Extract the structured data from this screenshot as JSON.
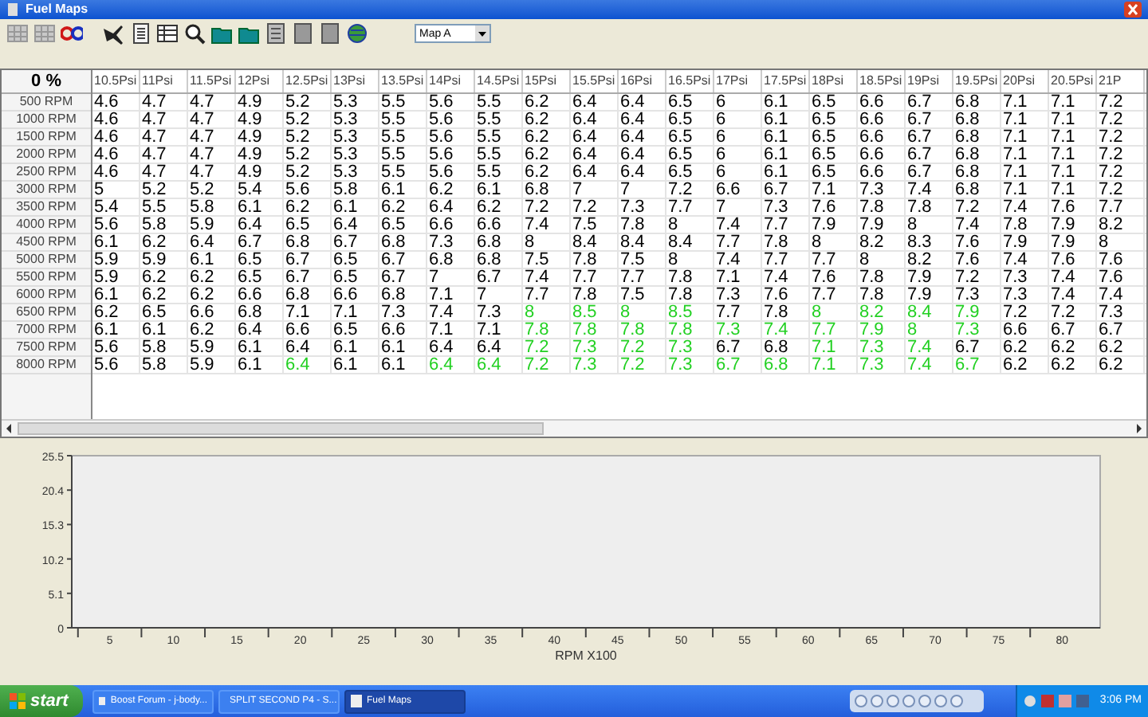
{
  "window": {
    "title": "Fuel Maps"
  },
  "toolbar": {
    "map_select": "Map A"
  },
  "table": {
    "corner": "0 %",
    "columns": [
      "10.5Psi",
      "11Psi",
      "11.5Psi",
      "12Psi",
      "12.5Psi",
      "13Psi",
      "13.5Psi",
      "14Psi",
      "14.5Psi",
      "15Psi",
      "15.5Psi",
      "16Psi",
      "16.5Psi",
      "17Psi",
      "17.5Psi",
      "18Psi",
      "18.5Psi",
      "19Psi",
      "19.5Psi",
      "20Psi",
      "20.5Psi",
      "21P"
    ],
    "rows": [
      {
        "label": "500 RPM",
        "cells": [
          {
            "value": "4.6",
            "highlighted": false
          },
          {
            "value": "4.7",
            "highlighted": false
          },
          {
            "value": "4.7",
            "highlighted": false
          },
          {
            "value": "4.9",
            "highlighted": false
          },
          {
            "value": "5.2",
            "highlighted": false
          },
          {
            "value": "5.3",
            "highlighted": false
          },
          {
            "value": "5.5",
            "highlighted": false
          },
          {
            "value": "5.6",
            "highlighted": false
          },
          {
            "value": "5.5",
            "highlighted": false
          },
          {
            "value": "6.2",
            "highlighted": false
          },
          {
            "value": "6.4",
            "highlighted": false
          },
          {
            "value": "6.4",
            "highlighted": false
          },
          {
            "value": "6.5",
            "highlighted": false
          },
          {
            "value": "6",
            "highlighted": false
          },
          {
            "value": "6.1",
            "highlighted": false
          },
          {
            "value": "6.5",
            "highlighted": false
          },
          {
            "value": "6.6",
            "highlighted": false
          },
          {
            "value": "6.7",
            "highlighted": false
          },
          {
            "value": "6.8",
            "highlighted": false
          },
          {
            "value": "7.1",
            "highlighted": false
          },
          {
            "value": "7.1",
            "highlighted": false
          },
          {
            "value": "7.2",
            "highlighted": false
          }
        ]
      },
      {
        "label": "1000 RPM",
        "cells": [
          {
            "value": "4.6",
            "highlighted": false
          },
          {
            "value": "4.7",
            "highlighted": false
          },
          {
            "value": "4.7",
            "highlighted": false
          },
          {
            "value": "4.9",
            "highlighted": false
          },
          {
            "value": "5.2",
            "highlighted": false
          },
          {
            "value": "5.3",
            "highlighted": false
          },
          {
            "value": "5.5",
            "highlighted": false
          },
          {
            "value": "5.6",
            "highlighted": false
          },
          {
            "value": "5.5",
            "highlighted": false
          },
          {
            "value": "6.2",
            "highlighted": false
          },
          {
            "value": "6.4",
            "highlighted": false
          },
          {
            "value": "6.4",
            "highlighted": false
          },
          {
            "value": "6.5",
            "highlighted": false
          },
          {
            "value": "6",
            "highlighted": false
          },
          {
            "value": "6.1",
            "highlighted": false
          },
          {
            "value": "6.5",
            "highlighted": false
          },
          {
            "value": "6.6",
            "highlighted": false
          },
          {
            "value": "6.7",
            "highlighted": false
          },
          {
            "value": "6.8",
            "highlighted": false
          },
          {
            "value": "7.1",
            "highlighted": false
          },
          {
            "value": "7.1",
            "highlighted": false
          },
          {
            "value": "7.2",
            "highlighted": false
          }
        ]
      },
      {
        "label": "1500 RPM",
        "cells": [
          {
            "value": "4.6",
            "highlighted": false
          },
          {
            "value": "4.7",
            "highlighted": false
          },
          {
            "value": "4.7",
            "highlighted": false
          },
          {
            "value": "4.9",
            "highlighted": false
          },
          {
            "value": "5.2",
            "highlighted": false
          },
          {
            "value": "5.3",
            "highlighted": false
          },
          {
            "value": "5.5",
            "highlighted": false
          },
          {
            "value": "5.6",
            "highlighted": false
          },
          {
            "value": "5.5",
            "highlighted": false
          },
          {
            "value": "6.2",
            "highlighted": false
          },
          {
            "value": "6.4",
            "highlighted": false
          },
          {
            "value": "6.4",
            "highlighted": false
          },
          {
            "value": "6.5",
            "highlighted": false
          },
          {
            "value": "6",
            "highlighted": false
          },
          {
            "value": "6.1",
            "highlighted": false
          },
          {
            "value": "6.5",
            "highlighted": false
          },
          {
            "value": "6.6",
            "highlighted": false
          },
          {
            "value": "6.7",
            "highlighted": false
          },
          {
            "value": "6.8",
            "highlighted": false
          },
          {
            "value": "7.1",
            "highlighted": false
          },
          {
            "value": "7.1",
            "highlighted": false
          },
          {
            "value": "7.2",
            "highlighted": false
          }
        ]
      },
      {
        "label": "2000 RPM",
        "cells": [
          {
            "value": "4.6",
            "highlighted": false
          },
          {
            "value": "4.7",
            "highlighted": false
          },
          {
            "value": "4.7",
            "highlighted": false
          },
          {
            "value": "4.9",
            "highlighted": false
          },
          {
            "value": "5.2",
            "highlighted": false
          },
          {
            "value": "5.3",
            "highlighted": false
          },
          {
            "value": "5.5",
            "highlighted": false
          },
          {
            "value": "5.6",
            "highlighted": false
          },
          {
            "value": "5.5",
            "highlighted": false
          },
          {
            "value": "6.2",
            "highlighted": false
          },
          {
            "value": "6.4",
            "highlighted": false
          },
          {
            "value": "6.4",
            "highlighted": false
          },
          {
            "value": "6.5",
            "highlighted": false
          },
          {
            "value": "6",
            "highlighted": false
          },
          {
            "value": "6.1",
            "highlighted": false
          },
          {
            "value": "6.5",
            "highlighted": false
          },
          {
            "value": "6.6",
            "highlighted": false
          },
          {
            "value": "6.7",
            "highlighted": false
          },
          {
            "value": "6.8",
            "highlighted": false
          },
          {
            "value": "7.1",
            "highlighted": false
          },
          {
            "value": "7.1",
            "highlighted": false
          },
          {
            "value": "7.2",
            "highlighted": false
          }
        ]
      },
      {
        "label": "2500 RPM",
        "cells": [
          {
            "value": "4.6",
            "highlighted": false
          },
          {
            "value": "4.7",
            "highlighted": false
          },
          {
            "value": "4.7",
            "highlighted": false
          },
          {
            "value": "4.9",
            "highlighted": false
          },
          {
            "value": "5.2",
            "highlighted": false
          },
          {
            "value": "5.3",
            "highlighted": false
          },
          {
            "value": "5.5",
            "highlighted": false
          },
          {
            "value": "5.6",
            "highlighted": false
          },
          {
            "value": "5.5",
            "highlighted": false
          },
          {
            "value": "6.2",
            "highlighted": false
          },
          {
            "value": "6.4",
            "highlighted": false
          },
          {
            "value": "6.4",
            "highlighted": false
          },
          {
            "value": "6.5",
            "highlighted": false
          },
          {
            "value": "6",
            "highlighted": false
          },
          {
            "value": "6.1",
            "highlighted": false
          },
          {
            "value": "6.5",
            "highlighted": false
          },
          {
            "value": "6.6",
            "highlighted": false
          },
          {
            "value": "6.7",
            "highlighted": false
          },
          {
            "value": "6.8",
            "highlighted": false
          },
          {
            "value": "7.1",
            "highlighted": false
          },
          {
            "value": "7.1",
            "highlighted": false
          },
          {
            "value": "7.2",
            "highlighted": false
          }
        ]
      },
      {
        "label": "3000 RPM",
        "cells": [
          {
            "value": "5",
            "highlighted": false
          },
          {
            "value": "5.2",
            "highlighted": false
          },
          {
            "value": "5.2",
            "highlighted": false
          },
          {
            "value": "5.4",
            "highlighted": false
          },
          {
            "value": "5.6",
            "highlighted": false
          },
          {
            "value": "5.8",
            "highlighted": false
          },
          {
            "value": "6.1",
            "highlighted": false
          },
          {
            "value": "6.2",
            "highlighted": false
          },
          {
            "value": "6.1",
            "highlighted": false
          },
          {
            "value": "6.8",
            "highlighted": false
          },
          {
            "value": "7",
            "highlighted": false
          },
          {
            "value": "7",
            "highlighted": false
          },
          {
            "value": "7.2",
            "highlighted": false
          },
          {
            "value": "6.6",
            "highlighted": false
          },
          {
            "value": "6.7",
            "highlighted": false
          },
          {
            "value": "7.1",
            "highlighted": false
          },
          {
            "value": "7.3",
            "highlighted": false
          },
          {
            "value": "7.4",
            "highlighted": false
          },
          {
            "value": "6.8",
            "highlighted": false
          },
          {
            "value": "7.1",
            "highlighted": false
          },
          {
            "value": "7.1",
            "highlighted": false
          },
          {
            "value": "7.2",
            "highlighted": false
          }
        ]
      },
      {
        "label": "3500 RPM",
        "cells": [
          {
            "value": "5.4",
            "highlighted": false
          },
          {
            "value": "5.5",
            "highlighted": false
          },
          {
            "value": "5.8",
            "highlighted": false
          },
          {
            "value": "6.1",
            "highlighted": false
          },
          {
            "value": "6.2",
            "highlighted": false
          },
          {
            "value": "6.1",
            "highlighted": false
          },
          {
            "value": "6.2",
            "highlighted": false
          },
          {
            "value": "6.4",
            "highlighted": false
          },
          {
            "value": "6.2",
            "highlighted": false
          },
          {
            "value": "7.2",
            "highlighted": false
          },
          {
            "value": "7.2",
            "highlighted": false
          },
          {
            "value": "7.3",
            "highlighted": false
          },
          {
            "value": "7.7",
            "highlighted": false
          },
          {
            "value": "7",
            "highlighted": false
          },
          {
            "value": "7.3",
            "highlighted": false
          },
          {
            "value": "7.6",
            "highlighted": false
          },
          {
            "value": "7.8",
            "highlighted": false
          },
          {
            "value": "7.8",
            "highlighted": false
          },
          {
            "value": "7.2",
            "highlighted": false
          },
          {
            "value": "7.4",
            "highlighted": false
          },
          {
            "value": "7.6",
            "highlighted": false
          },
          {
            "value": "7.7",
            "highlighted": false
          }
        ]
      },
      {
        "label": "4000 RPM",
        "cells": [
          {
            "value": "5.6",
            "highlighted": false
          },
          {
            "value": "5.8",
            "highlighted": false
          },
          {
            "value": "5.9",
            "highlighted": false
          },
          {
            "value": "6.4",
            "highlighted": false
          },
          {
            "value": "6.5",
            "highlighted": false
          },
          {
            "value": "6.4",
            "highlighted": false
          },
          {
            "value": "6.5",
            "highlighted": false
          },
          {
            "value": "6.6",
            "highlighted": false
          },
          {
            "value": "6.6",
            "highlighted": false
          },
          {
            "value": "7.4",
            "highlighted": false
          },
          {
            "value": "7.5",
            "highlighted": false
          },
          {
            "value": "7.8",
            "highlighted": false
          },
          {
            "value": "8",
            "highlighted": false
          },
          {
            "value": "7.4",
            "highlighted": false
          },
          {
            "value": "7.7",
            "highlighted": false
          },
          {
            "value": "7.9",
            "highlighted": false
          },
          {
            "value": "7.9",
            "highlighted": false
          },
          {
            "value": "8",
            "highlighted": false
          },
          {
            "value": "7.4",
            "highlighted": false
          },
          {
            "value": "7.8",
            "highlighted": false
          },
          {
            "value": "7.9",
            "highlighted": false
          },
          {
            "value": "8.2",
            "highlighted": false
          }
        ]
      },
      {
        "label": "4500 RPM",
        "cells": [
          {
            "value": "6.1",
            "highlighted": false
          },
          {
            "value": "6.2",
            "highlighted": false
          },
          {
            "value": "6.4",
            "highlighted": false
          },
          {
            "value": "6.7",
            "highlighted": false
          },
          {
            "value": "6.8",
            "highlighted": false
          },
          {
            "value": "6.7",
            "highlighted": false
          },
          {
            "value": "6.8",
            "highlighted": false
          },
          {
            "value": "7.3",
            "highlighted": false
          },
          {
            "value": "6.8",
            "highlighted": false
          },
          {
            "value": "8",
            "highlighted": false
          },
          {
            "value": "8.4",
            "highlighted": false
          },
          {
            "value": "8.4",
            "highlighted": false
          },
          {
            "value": "8.4",
            "highlighted": false
          },
          {
            "value": "7.7",
            "highlighted": false
          },
          {
            "value": "7.8",
            "highlighted": false
          },
          {
            "value": "8",
            "highlighted": false
          },
          {
            "value": "8.2",
            "highlighted": false
          },
          {
            "value": "8.3",
            "highlighted": false
          },
          {
            "value": "7.6",
            "highlighted": false
          },
          {
            "value": "7.9",
            "highlighted": false
          },
          {
            "value": "7.9",
            "highlighted": false
          },
          {
            "value": "8",
            "highlighted": false
          }
        ]
      },
      {
        "label": "5000 RPM",
        "cells": [
          {
            "value": "5.9",
            "highlighted": false
          },
          {
            "value": "5.9",
            "highlighted": false
          },
          {
            "value": "6.1",
            "highlighted": false
          },
          {
            "value": "6.5",
            "highlighted": false
          },
          {
            "value": "6.7",
            "highlighted": false
          },
          {
            "value": "6.5",
            "highlighted": false
          },
          {
            "value": "6.7",
            "highlighted": false
          },
          {
            "value": "6.8",
            "highlighted": false
          },
          {
            "value": "6.8",
            "highlighted": false
          },
          {
            "value": "7.5",
            "highlighted": false
          },
          {
            "value": "7.8",
            "highlighted": false
          },
          {
            "value": "7.5",
            "highlighted": false
          },
          {
            "value": "8",
            "highlighted": false
          },
          {
            "value": "7.4",
            "highlighted": false
          },
          {
            "value": "7.7",
            "highlighted": false
          },
          {
            "value": "7.7",
            "highlighted": false
          },
          {
            "value": "8",
            "highlighted": false
          },
          {
            "value": "8.2",
            "highlighted": false
          },
          {
            "value": "7.6",
            "highlighted": false
          },
          {
            "value": "7.4",
            "highlighted": false
          },
          {
            "value": "7.6",
            "highlighted": false
          },
          {
            "value": "7.6",
            "highlighted": false
          }
        ]
      },
      {
        "label": "5500 RPM",
        "cells": [
          {
            "value": "5.9",
            "highlighted": false
          },
          {
            "value": "6.2",
            "highlighted": false
          },
          {
            "value": "6.2",
            "highlighted": false
          },
          {
            "value": "6.5",
            "highlighted": false
          },
          {
            "value": "6.7",
            "highlighted": false
          },
          {
            "value": "6.5",
            "highlighted": false
          },
          {
            "value": "6.7",
            "highlighted": false
          },
          {
            "value": "7",
            "highlighted": false
          },
          {
            "value": "6.7",
            "highlighted": false
          },
          {
            "value": "7.4",
            "highlighted": false
          },
          {
            "value": "7.7",
            "highlighted": false
          },
          {
            "value": "7.7",
            "highlighted": false
          },
          {
            "value": "7.8",
            "highlighted": false
          },
          {
            "value": "7.1",
            "highlighted": false
          },
          {
            "value": "7.4",
            "highlighted": false
          },
          {
            "value": "7.6",
            "highlighted": false
          },
          {
            "value": "7.8",
            "highlighted": false
          },
          {
            "value": "7.9",
            "highlighted": false
          },
          {
            "value": "7.2",
            "highlighted": false
          },
          {
            "value": "7.3",
            "highlighted": false
          },
          {
            "value": "7.4",
            "highlighted": false
          },
          {
            "value": "7.6",
            "highlighted": false
          }
        ]
      },
      {
        "label": "6000 RPM",
        "cells": [
          {
            "value": "6.1",
            "highlighted": false
          },
          {
            "value": "6.2",
            "highlighted": false
          },
          {
            "value": "6.2",
            "highlighted": false
          },
          {
            "value": "6.6",
            "highlighted": false
          },
          {
            "value": "6.8",
            "highlighted": false
          },
          {
            "value": "6.6",
            "highlighted": false
          },
          {
            "value": "6.8",
            "highlighted": false
          },
          {
            "value": "7.1",
            "highlighted": false
          },
          {
            "value": "7",
            "highlighted": false
          },
          {
            "value": "7.7",
            "highlighted": false
          },
          {
            "value": "7.8",
            "highlighted": false
          },
          {
            "value": "7.5",
            "highlighted": false
          },
          {
            "value": "7.8",
            "highlighted": false
          },
          {
            "value": "7.3",
            "highlighted": false
          },
          {
            "value": "7.6",
            "highlighted": false
          },
          {
            "value": "7.7",
            "highlighted": false
          },
          {
            "value": "7.8",
            "highlighted": false
          },
          {
            "value": "7.9",
            "highlighted": false
          },
          {
            "value": "7.3",
            "highlighted": false
          },
          {
            "value": "7.3",
            "highlighted": false
          },
          {
            "value": "7.4",
            "highlighted": false
          },
          {
            "value": "7.4",
            "highlighted": false
          }
        ]
      },
      {
        "label": "6500 RPM",
        "cells": [
          {
            "value": "6.2",
            "highlighted": false
          },
          {
            "value": "6.5",
            "highlighted": false
          },
          {
            "value": "6.6",
            "highlighted": false
          },
          {
            "value": "6.8",
            "highlighted": false
          },
          {
            "value": "7.1",
            "highlighted": false
          },
          {
            "value": "7.1",
            "highlighted": false
          },
          {
            "value": "7.3",
            "highlighted": false
          },
          {
            "value": "7.4",
            "highlighted": false
          },
          {
            "value": "7.3",
            "highlighted": false
          },
          {
            "value": "8",
            "highlighted": true
          },
          {
            "value": "8.5",
            "highlighted": true
          },
          {
            "value": "8",
            "highlighted": true
          },
          {
            "value": "8.5",
            "highlighted": true
          },
          {
            "value": "7.7",
            "highlighted": false
          },
          {
            "value": "7.8",
            "highlighted": false
          },
          {
            "value": "8",
            "highlighted": true
          },
          {
            "value": "8.2",
            "highlighted": true
          },
          {
            "value": "8.4",
            "highlighted": true
          },
          {
            "value": "7.9",
            "highlighted": true
          },
          {
            "value": "7.2",
            "highlighted": false
          },
          {
            "value": "7.2",
            "highlighted": false
          },
          {
            "value": "7.3",
            "highlighted": false
          }
        ]
      },
      {
        "label": "7000 RPM",
        "cells": [
          {
            "value": "6.1",
            "highlighted": false
          },
          {
            "value": "6.1",
            "highlighted": false
          },
          {
            "value": "6.2",
            "highlighted": false
          },
          {
            "value": "6.4",
            "highlighted": false
          },
          {
            "value": "6.6",
            "highlighted": false
          },
          {
            "value": "6.5",
            "highlighted": false
          },
          {
            "value": "6.6",
            "highlighted": false
          },
          {
            "value": "7.1",
            "highlighted": false
          },
          {
            "value": "7.1",
            "highlighted": false
          },
          {
            "value": "7.8",
            "highlighted": true
          },
          {
            "value": "7.8",
            "highlighted": true
          },
          {
            "value": "7.8",
            "highlighted": true
          },
          {
            "value": "7.8",
            "highlighted": true
          },
          {
            "value": "7.3",
            "highlighted": true
          },
          {
            "value": "7.4",
            "highlighted": true
          },
          {
            "value": "7.7",
            "highlighted": true
          },
          {
            "value": "7.9",
            "highlighted": true
          },
          {
            "value": "8",
            "highlighted": true
          },
          {
            "value": "7.3",
            "highlighted": true
          },
          {
            "value": "6.6",
            "highlighted": false
          },
          {
            "value": "6.7",
            "highlighted": false
          },
          {
            "value": "6.7",
            "highlighted": false
          }
        ]
      },
      {
        "label": "7500 RPM",
        "cells": [
          {
            "value": "5.6",
            "highlighted": false
          },
          {
            "value": "5.8",
            "highlighted": false
          },
          {
            "value": "5.9",
            "highlighted": false
          },
          {
            "value": "6.1",
            "highlighted": false
          },
          {
            "value": "6.4",
            "highlighted": false
          },
          {
            "value": "6.1",
            "highlighted": false
          },
          {
            "value": "6.1",
            "highlighted": false
          },
          {
            "value": "6.4",
            "highlighted": false
          },
          {
            "value": "6.4",
            "highlighted": false
          },
          {
            "value": "7.2",
            "highlighted": true
          },
          {
            "value": "7.3",
            "highlighted": true
          },
          {
            "value": "7.2",
            "highlighted": true
          },
          {
            "value": "7.3",
            "highlighted": true
          },
          {
            "value": "6.7",
            "highlighted": false
          },
          {
            "value": "6.8",
            "highlighted": false
          },
          {
            "value": "7.1",
            "highlighted": true
          },
          {
            "value": "7.3",
            "highlighted": true
          },
          {
            "value": "7.4",
            "highlighted": true
          },
          {
            "value": "6.7",
            "highlighted": false
          },
          {
            "value": "6.2",
            "highlighted": false
          },
          {
            "value": "6.2",
            "highlighted": false
          },
          {
            "value": "6.2",
            "highlighted": false
          }
        ]
      },
      {
        "label": "8000 RPM",
        "cells": [
          {
            "value": "5.6",
            "highlighted": false
          },
          {
            "value": "5.8",
            "highlighted": false
          },
          {
            "value": "5.9",
            "highlighted": false
          },
          {
            "value": "6.1",
            "highlighted": false
          },
          {
            "value": "6.4",
            "highlighted": true
          },
          {
            "value": "6.1",
            "highlighted": false
          },
          {
            "value": "6.1",
            "highlighted": false
          },
          {
            "value": "6.4",
            "highlighted": true
          },
          {
            "value": "6.4",
            "highlighted": true
          },
          {
            "value": "7.2",
            "highlighted": true
          },
          {
            "value": "7.3",
            "highlighted": true
          },
          {
            "value": "7.2",
            "highlighted": true
          },
          {
            "value": "7.3",
            "highlighted": true
          },
          {
            "value": "6.7",
            "highlighted": true
          },
          {
            "value": "6.8",
            "highlighted": true
          },
          {
            "value": "7.1",
            "highlighted": true
          },
          {
            "value": "7.3",
            "highlighted": true
          },
          {
            "value": "7.4",
            "highlighted": true
          },
          {
            "value": "6.7",
            "highlighted": true
          },
          {
            "value": "6.2",
            "highlighted": false
          },
          {
            "value": "6.2",
            "highlighted": false
          },
          {
            "value": "6.2",
            "highlighted": false
          }
        ]
      }
    ]
  },
  "chart": {
    "chart_data": {
      "type": "line",
      "xlabel": "RPM X100",
      "xlim": [
        2,
        83
      ],
      "ylim": [
        0,
        25.5
      ],
      "xticks": [
        5,
        10,
        15,
        20,
        25,
        30,
        35,
        40,
        45,
        50,
        55,
        60,
        65,
        70,
        75,
        80
      ],
      "yticks": [
        {
          "value": 0,
          "label": "0"
        },
        {
          "value": 5.1,
          "label": "5.1"
        },
        {
          "value": 10.2,
          "label": "10.2"
        },
        {
          "value": 15.3,
          "label": "15.3"
        },
        {
          "value": 20.4,
          "label": "20.4"
        },
        {
          "value": 25.5,
          "label": "25.5"
        }
      ]
    }
  },
  "taskbar": {
    "start": "start",
    "tasks": [
      {
        "label": "Boost Forum - j-body...",
        "selected": false
      },
      {
        "label": "SPLIT SECOND P4 - S...",
        "selected": false
      },
      {
        "label": "Fuel Maps",
        "selected": true
      }
    ],
    "clock": "3:06 PM"
  }
}
